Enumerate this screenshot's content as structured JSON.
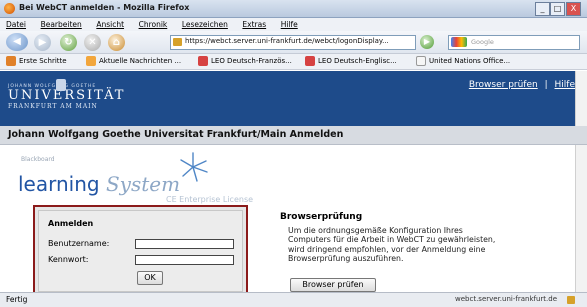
{
  "window": {
    "title": "Bei WebCT anmelden - Mozilla Firefox",
    "controls": [
      "_",
      "□",
      "X"
    ]
  },
  "menu": [
    "Datei",
    "Bearbeiten",
    "Ansicht",
    "Chronik",
    "Lesezeichen",
    "Extras",
    "Hilfe"
  ],
  "nav": {
    "url": "https://webct.server.uni-frankfurt.de/webct/logonDisplay...",
    "search_placeholder": "Google"
  },
  "bookmarks": [
    {
      "label": "Erste Schritte",
      "color": "#e0812a"
    },
    {
      "label": "Aktuelle Nachrichten ...",
      "color": "#f2a63c"
    },
    {
      "label": "LEO Deutsch-Französ...",
      "color": "#d64242"
    },
    {
      "label": "LEO Deutsch-Englisc...",
      "color": "#d64242"
    },
    {
      "label": "United Nations Office...",
      "color": "#f6f6f6"
    }
  ],
  "header": {
    "uni_small": "JOHANN WOLFGANG GOETHE",
    "uni_name": "UNIVERSITÄT",
    "uni_city": "FRANKFURT AM MAIN",
    "link_browser": "Browser prüfen",
    "separator": "|",
    "link_help": "Hilfe"
  },
  "page_title": "Johann Wolfgang Goethe Universitat Frankfurt/Main Anmelden",
  "logo": {
    "blackboard": "Blackboard",
    "learning": "learning",
    "system": "System",
    "edition": "CE Enterprise License"
  },
  "login": {
    "heading": "Anmelden",
    "username_label": "Benutzername:",
    "password_label": "Kennwort:",
    "ok_label": "OK"
  },
  "browser_check": {
    "heading": "Browserprüfung",
    "text": "Um die ordnungsgemäße Konfiguration Ihres Computers für die Arbeit in WebCT zu gewährleisten, wird dringend empfohlen, vor der Anmeldung eine Browserprüfung auszuführen.",
    "button_label": "Browser prüfen"
  },
  "status": {
    "left": "Fertig",
    "right": "webct.server.uni-frankfurt.de"
  }
}
